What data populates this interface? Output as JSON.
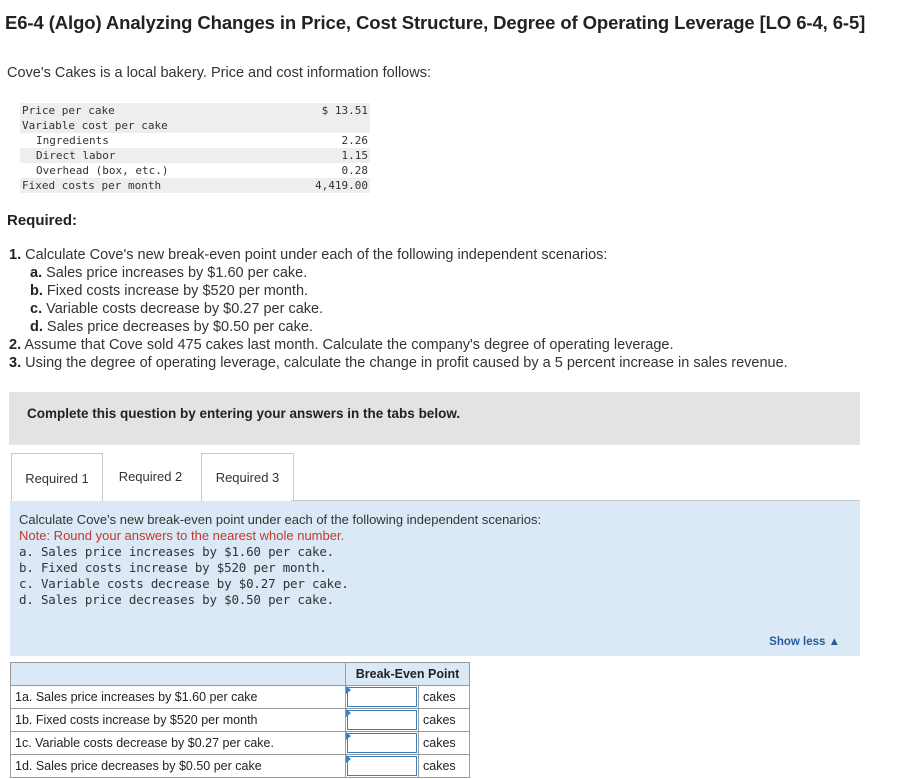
{
  "title": "E6-4 (Algo) Analyzing Changes in Price, Cost Structure, Degree of Operating Leverage [LO 6-4, 6-5]",
  "intro": "Cove's Cakes is a local bakery. Price and cost information follows:",
  "cost_table": [
    {
      "label": "Price per cake",
      "value": "$ 13.51"
    },
    {
      "label": "Variable cost per cake",
      "value": ""
    },
    {
      "label": "Ingredients",
      "value": "2.26"
    },
    {
      "label": "Direct labor",
      "value": "1.15"
    },
    {
      "label": "Overhead (box, etc.)",
      "value": "0.28"
    },
    {
      "label": "Fixed costs per month",
      "value": "4,419.00"
    }
  ],
  "required_heading": "Required:",
  "questions": {
    "q1_num": "1.",
    "q1": "Calculate Cove's new break-even point under each of the following independent scenarios:",
    "q1_subs": [
      {
        "letter": "a.",
        "text": "Sales price increases by $1.60 per cake."
      },
      {
        "letter": "b.",
        "text": "Fixed costs increase by $520 per month."
      },
      {
        "letter": "c.",
        "text": "Variable costs decrease by $0.27 per cake."
      },
      {
        "letter": "d.",
        "text": "Sales price decreases by $0.50 per cake."
      }
    ],
    "q2_num": "2.",
    "q2": "Assume that Cove sold 475 cakes last month. Calculate the company's degree of operating leverage.",
    "q3_num": "3.",
    "q3": "Using the degree of operating leverage, calculate the change in profit caused by a 5 percent increase in sales revenue."
  },
  "instruction": "Complete this question by entering your answers in the tabs below.",
  "tabs": [
    "Required 1",
    "Required 2",
    "Required 3"
  ],
  "panel": {
    "heading": "Calculate Cove's new break-even point under each of the following independent scenarios:",
    "note": "Note: Round your answers to the nearest whole number.",
    "items": [
      "a. Sales price increases by $1.60 per cake.",
      "b. Fixed costs increase by $520 per month.",
      "c. Variable costs decrease by $0.27 per cake.",
      "d. Sales price decreases by $0.50 per cake."
    ],
    "show_less": "Show less"
  },
  "answer_table": {
    "column_header": "Break-Even Point",
    "rows": [
      {
        "label": "1a. Sales price increases by $1.60 per cake",
        "value": "",
        "unit": "cakes"
      },
      {
        "label": "1b. Fixed costs increase by $520 per month",
        "value": "",
        "unit": "cakes"
      },
      {
        "label": "1c. Variable costs decrease by $0.27 per cake.",
        "value": "",
        "unit": "cakes"
      },
      {
        "label": "1d. Sales price decreases by $0.50 per cake",
        "value": "",
        "unit": "cakes"
      }
    ]
  },
  "colors": {
    "panel_bg": "#dbe9f7",
    "note_red": "#c0392b",
    "link_blue": "#2a5b9c",
    "instruction_bg": "#e3e3e3"
  }
}
